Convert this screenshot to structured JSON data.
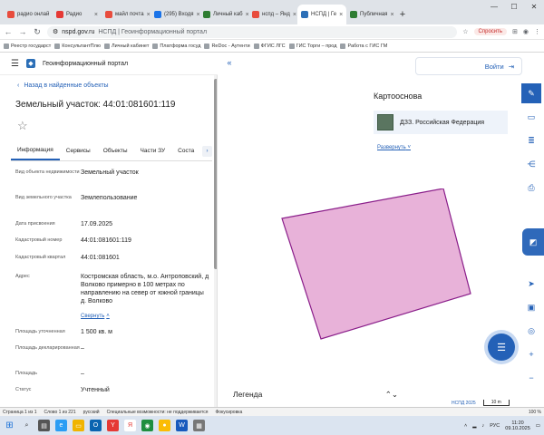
{
  "browser": {
    "tabs": [
      {
        "label": "радио онлай",
        "color": "#e84c3d"
      },
      {
        "label": "Радио",
        "color": "#e53935"
      },
      {
        "label": "майл почта",
        "color": "#e84c3d"
      },
      {
        "label": "(295) Входя",
        "color": "#1a73e8"
      },
      {
        "label": "Личный каб",
        "color": "#2e7d32"
      },
      {
        "label": "нспд – Янд",
        "color": "#e84c3d"
      },
      {
        "label": "НСПД | Ге",
        "color": "#2c6fb7",
        "active": true
      },
      {
        "label": "Публичная",
        "color": "#2e7d32"
      }
    ],
    "url": "nspd.gov.ru",
    "page_title": "НСПД | Геоинформационный портал",
    "ask_label": "Спросить"
  },
  "bookmarks": [
    "Реестр государст",
    "КонсультантПлю",
    "Личный кабинет",
    "Платформа госуд",
    "ReDoc - Аутенти",
    "ФГИС ЛГС",
    "ГИС Торги – прод",
    "Работа с ГИС ГМ"
  ],
  "app": {
    "title": "Геоинформационный портал"
  },
  "panel": {
    "back_label": "Назад в найденные объекты",
    "object_title": "Земельный участок: 44:01:081601:119",
    "tabs": [
      "Информация",
      "Сервисы",
      "Объекты",
      "Части ЗУ",
      "Соста"
    ],
    "fields": [
      {
        "label": "Вид объекта недвижимости",
        "value": "Земельный участок"
      },
      {
        "label": "Вид земельного участка",
        "value": "Землепользование"
      },
      {
        "label": "Дата присвоения",
        "value": "17.09.2025"
      },
      {
        "label": "Кадастровый номер",
        "value": "44:01:081601:119"
      },
      {
        "label": "Кадастровый квартал",
        "value": "44:01:081601"
      },
      {
        "label": "Адрес",
        "value": "Костромская область, м.о. Антроповский, д Волково примерно в 100 метрах по направлению на север от южной границы д. Волково"
      },
      {
        "label": "Площадь уточненная",
        "value": "1 500 кв. м"
      },
      {
        "label": "Площадь декларированная",
        "value": "–"
      },
      {
        "label": "Площадь",
        "value": "–"
      },
      {
        "label": "Статус",
        "value": "Учтенный"
      }
    ],
    "collapse_label": "Свернуть"
  },
  "map": {
    "login_label": "Войти",
    "basemap_title": "Картооснова",
    "basemap_name": "ДЗЗ. Российская Федерация",
    "reserve_label": "Развернуть",
    "legend_label": "Легенда",
    "version": "НСПД 2025",
    "scale": "10 m",
    "parcel_fill": "#e8b2d9",
    "parcel_stroke": "#8a1e8a"
  },
  "statusbar": {
    "page": "Страница 1 из 1",
    "words": "Слово 1 из 221",
    "lang": "русский",
    "accessibility": "Специальные возможности: не поддерживается",
    "focus": "Фокусировка",
    "zoom": "100 %"
  },
  "taskbar": {
    "lang": "РУС",
    "time": "11:20",
    "date": "09.10.2025"
  }
}
